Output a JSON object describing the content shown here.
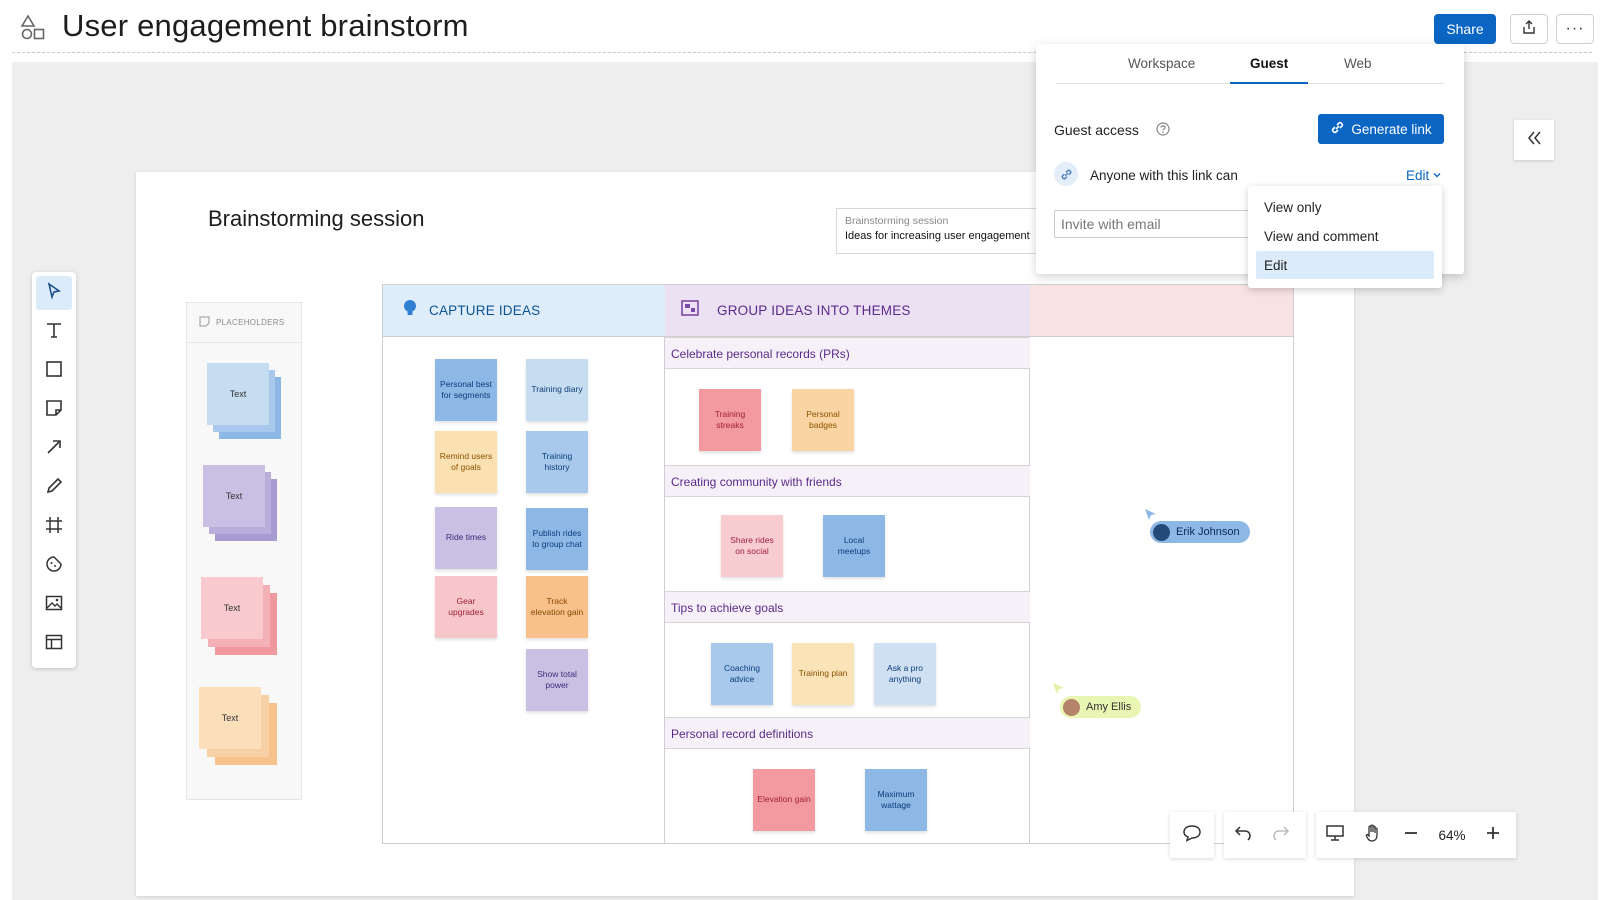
{
  "header": {
    "title": "User engagement brainstorm",
    "share_label": "Share",
    "more_label": "···"
  },
  "board": {
    "title": "Brainstorming session",
    "info_card": {
      "title": "Brainstorming session",
      "subtitle": "Ideas for increasing user engagement"
    },
    "placeholders": {
      "header": "PLACEHOLDERS",
      "items": [
        "Text",
        "Text",
        "Text",
        "Text"
      ]
    },
    "capture": {
      "title": "CAPTURE IDEAS",
      "notes": [
        "Personal best for segments",
        "Training diary",
        "Remind users of goals",
        "Training history",
        "Ride times",
        "Publish rides to group chat",
        "Gear upgrades",
        "Track elevation gain",
        "Show total power"
      ]
    },
    "group": {
      "title": "GROUP IDEAS INTO THEMES",
      "themes": [
        {
          "title": "Celebrate personal records (PRs)",
          "notes": [
            "Training streaks",
            "Personal badges"
          ]
        },
        {
          "title": "Creating community with friends",
          "notes": [
            "Share rides on social",
            "Local meetups"
          ]
        },
        {
          "title": "Tips to achieve goals",
          "notes": [
            "Coaching advice",
            "Training plan",
            "Ask a pro anything"
          ]
        },
        {
          "title": "Personal record definitions",
          "notes": [
            "Elevation gain",
            "Maximum wattage"
          ]
        }
      ]
    }
  },
  "cursors": [
    {
      "name": "Erik Johnson"
    },
    {
      "name": "Amy Ellis"
    }
  ],
  "zoom": "64%",
  "share_panel": {
    "tabs": [
      "Workspace",
      "Guest",
      "Web"
    ],
    "active_tab": "Guest",
    "guest_access_label": "Guest access",
    "generate_link_label": "Generate link",
    "link_permission_text": "Anyone with this link can",
    "permission_value": "Edit",
    "invite_placeholder": "Invite with email",
    "permission_options": [
      "View only",
      "View and comment",
      "Edit"
    ],
    "selected_option": "Edit"
  },
  "colors": {
    "accent": "#0a66c2",
    "note_blue": "#8db8e6",
    "note_lightblue": "#c6dcf1",
    "note_purple": "#c9c0e3",
    "note_pink": "#f6c6cb",
    "note_orange": "#f8cf9e",
    "note_red": "#f39aa0",
    "note_yellow": "#fbdfae"
  }
}
